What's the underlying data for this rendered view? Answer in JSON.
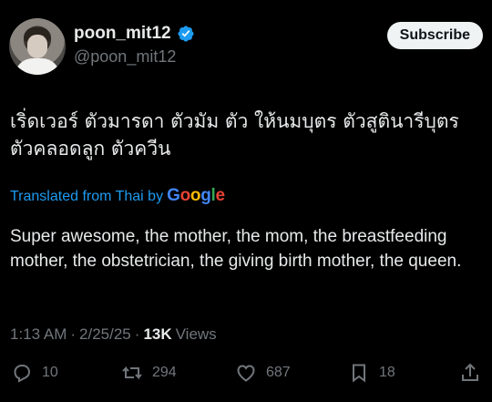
{
  "author": {
    "display_name": "poon_mit12",
    "handle": "@poon_mit12"
  },
  "subscribe_label": "Subscribe",
  "post": {
    "original_text": "เริ่ดเวอร์ ตัวมารดา ตัวมัม ตัว ให้นมบุตร ตัวสูตินารีบุตร ตัวคลอดลูก ตัวควีน",
    "translated_from": "Translated from Thai by",
    "translation_provider": "Google",
    "translation": "Super awesome, the mother, the mom, the breastfeeding mother, the obstetrician, the giving birth mother, the queen."
  },
  "meta": {
    "time": "1:13 AM",
    "separator": "·",
    "date": "2/25/25",
    "separator2": "·",
    "views_count": "13K",
    "views_label": "Views"
  },
  "actions": {
    "replies": "10",
    "reposts": "294",
    "likes": "687",
    "bookmarks": "18"
  },
  "colors": {
    "background": "#000000",
    "accent": "#1d9bf0",
    "muted": "#71767b",
    "text": "#e7e9ea"
  },
  "icons": [
    "verified-badge-icon",
    "reply-icon",
    "repost-icon",
    "like-icon",
    "bookmark-icon",
    "share-icon"
  ]
}
